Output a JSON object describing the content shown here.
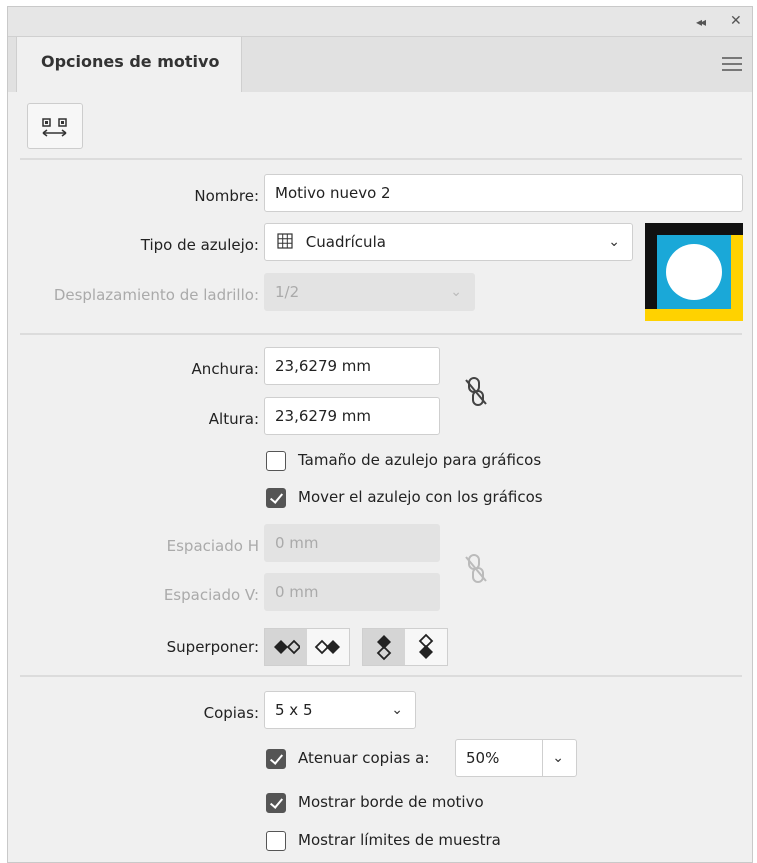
{
  "panel": {
    "title_tab": "Opciones de motivo",
    "collapse_glyph": "◂◂",
    "close_glyph": "✕"
  },
  "form": {
    "nombre_label": "Nombre:",
    "nombre_value": "Motivo nuevo 2",
    "tipo_label": "Tipo de azulejo:",
    "tipo_value": "Cuadrícula",
    "desplazamiento_label": "Desplazamiento de ladrillo:",
    "desplazamiento_value": "1/2",
    "anchura_label": "Anchura:",
    "anchura_value": "23,6279 mm",
    "altura_label": "Altura:",
    "altura_value": "23,6279 mm",
    "tamano_label": "Tamaño de azulejo para gráficos",
    "tamano_checked": false,
    "mover_label": "Mover el azulejo con los gráficos",
    "mover_checked": true,
    "espaciado_h_label": "Espaciado H",
    "espaciado_h_value": "0 mm",
    "espaciado_v_label": "Espaciado V:",
    "espaciado_v_value": "0 mm",
    "superponer_label": "Superponer:",
    "copias_label": "Copias:",
    "copias_value": "5 x 5",
    "atenuar_label": "Atenuar copias a:",
    "atenuar_checked": true,
    "atenuar_value": "50%",
    "mostrar_borde_label": "Mostrar borde de motivo",
    "mostrar_borde_checked": true,
    "mostrar_limites_label": "Mostrar límites de muestra",
    "mostrar_limites_checked": false
  },
  "icons": {
    "pattern_tool": "pattern-tile-tool-icon",
    "grid": "grid-icon",
    "link": "unlinked-chain-icon",
    "chevron": "chevron-down-icon"
  },
  "swatch_colors": {
    "border_yellow": "#ffd200",
    "black": "#111111",
    "blue": "#1aa8d8",
    "circle": "#ffffff"
  }
}
